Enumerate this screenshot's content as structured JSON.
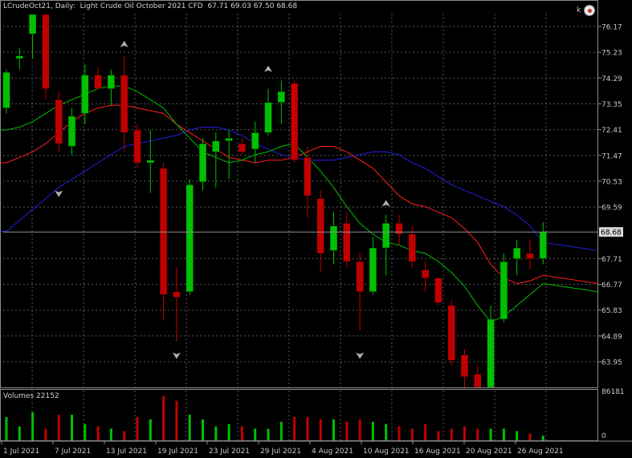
{
  "header": {
    "symbol": "LCrudeOct21",
    "timeframe": "Daily",
    "description": "Light Crude Oil October 2021 CFD",
    "ohlc": "67.71 69.03 67.50 68.68"
  },
  "volumes_label": "Volumes 22152",
  "badge_letter": "k",
  "current_price": "68.68",
  "colors": {
    "bull": "#00c000",
    "bear": "#c00000",
    "ma_fast": "#00c000",
    "ma_mid": "#ff2020",
    "ma_slow": "#2020e0",
    "grid": "#585858",
    "price_line": "#909090"
  },
  "price_axis": [
    "76.17",
    "75.23",
    "74.29",
    "73.35",
    "72.41",
    "71.47",
    "70.53",
    "69.59",
    "67.71",
    "66.77",
    "65.83",
    "64.89",
    "63.95"
  ],
  "volume_axis": [
    "86181",
    "0"
  ],
  "date_axis": [
    "1 Jul 2021",
    "7 Jul 2021",
    "13 Jul 2021",
    "19 Jul 2021",
    "23 Jul 2021",
    "29 Jul 2021",
    "4 Aug 2021",
    "10 Aug 2021",
    "16 Aug 2021",
    "20 Aug 2021",
    "26 Aug 2021"
  ],
  "chart_data": {
    "type": "candlestick",
    "candles": [
      {
        "o": 73.2,
        "h": 74.6,
        "l": 73.0,
        "c": 74.5,
        "v": 0.5
      },
      {
        "o": 75.0,
        "h": 75.4,
        "l": 74.6,
        "c": 75.1,
        "v": 0.3
      },
      {
        "o": 75.9,
        "h": 76.8,
        "l": 75.0,
        "c": 76.9,
        "v": 0.6
      },
      {
        "o": 77.0,
        "h": 77.2,
        "l": 73.5,
        "c": 73.9,
        "v": 0.25
      },
      {
        "o": 73.5,
        "h": 73.8,
        "l": 71.6,
        "c": 71.9,
        "v": 0.55
      },
      {
        "o": 71.8,
        "h": 73.2,
        "l": 71.5,
        "c": 72.9,
        "v": 0.55
      },
      {
        "o": 73.0,
        "h": 74.8,
        "l": 72.6,
        "c": 74.4,
        "v": 0.35
      },
      {
        "o": 74.4,
        "h": 74.7,
        "l": 73.9,
        "c": 73.9,
        "v": 0.3
      },
      {
        "o": 73.9,
        "h": 74.6,
        "l": 73.3,
        "c": 74.4,
        "v": 0.25
      },
      {
        "o": 74.4,
        "h": 75.1,
        "l": 71.6,
        "c": 72.3,
        "v": 0.2
      },
      {
        "o": 72.4,
        "h": 72.6,
        "l": 71.0,
        "c": 71.2,
        "v": 0.5
      },
      {
        "o": 71.2,
        "h": 72.4,
        "l": 70.1,
        "c": 71.3,
        "v": 0.45
      },
      {
        "o": 71.0,
        "h": 71.2,
        "l": 65.5,
        "c": 66.4,
        "v": 0.95
      },
      {
        "o": 66.5,
        "h": 67.4,
        "l": 64.7,
        "c": 66.3,
        "v": 0.85
      },
      {
        "o": 66.5,
        "h": 70.6,
        "l": 66.4,
        "c": 70.4,
        "v": 0.55
      },
      {
        "o": 70.5,
        "h": 72.1,
        "l": 70.2,
        "c": 71.9,
        "v": 0.45
      },
      {
        "o": 71.6,
        "h": 72.3,
        "l": 70.3,
        "c": 72.0,
        "v": 0.3
      },
      {
        "o": 72.0,
        "h": 72.4,
        "l": 70.6,
        "c": 72.1,
        "v": 0.35
      },
      {
        "o": 71.9,
        "h": 72.1,
        "l": 71.5,
        "c": 71.6,
        "v": 0.3
      },
      {
        "o": 71.7,
        "h": 72.7,
        "l": 71.2,
        "c": 72.3,
        "v": 0.25
      },
      {
        "o": 72.3,
        "h": 73.9,
        "l": 72.2,
        "c": 73.4,
        "v": 0.25
      },
      {
        "o": 73.4,
        "h": 74.2,
        "l": 72.6,
        "c": 73.8,
        "v": 0.4
      },
      {
        "o": 74.1,
        "h": 74.2,
        "l": 71.2,
        "c": 71.3,
        "v": 0.5
      },
      {
        "o": 71.4,
        "h": 71.8,
        "l": 69.2,
        "c": 70.0,
        "v": 0.5
      },
      {
        "o": 69.9,
        "h": 70.2,
        "l": 67.2,
        "c": 67.9,
        "v": 0.45
      },
      {
        "o": 68.0,
        "h": 69.4,
        "l": 67.5,
        "c": 68.9,
        "v": 0.45
      },
      {
        "o": 69.0,
        "h": 69.4,
        "l": 67.4,
        "c": 67.6,
        "v": 0.4
      },
      {
        "o": 67.6,
        "h": 67.9,
        "l": 65.1,
        "c": 66.5,
        "v": 0.45
      },
      {
        "o": 66.5,
        "h": 68.5,
        "l": 66.4,
        "c": 68.1,
        "v": 0.4
      },
      {
        "o": 68.1,
        "h": 69.3,
        "l": 67.1,
        "c": 69.0,
        "v": 0.35
      },
      {
        "o": 69.0,
        "h": 69.3,
        "l": 68.2,
        "c": 68.6,
        "v": 0.3
      },
      {
        "o": 68.6,
        "h": 68.9,
        "l": 67.4,
        "c": 67.6,
        "v": 0.25
      },
      {
        "o": 67.3,
        "h": 67.6,
        "l": 66.5,
        "c": 67.0,
        "v": 0.35
      },
      {
        "o": 67.0,
        "h": 67.0,
        "l": 66.0,
        "c": 66.1,
        "v": 0.2
      },
      {
        "o": 66.0,
        "h": 66.2,
        "l": 63.8,
        "c": 64.0,
        "v": 0.25
      },
      {
        "o": 64.2,
        "h": 64.4,
        "l": 62.5,
        "c": 63.4,
        "v": 0.3
      },
      {
        "o": 63.5,
        "h": 63.8,
        "l": 62.8,
        "c": 62.9,
        "v": 0.25
      },
      {
        "o": 63.0,
        "h": 66.0,
        "l": 62.8,
        "c": 65.5,
        "v": 0.25
      },
      {
        "o": 65.5,
        "h": 67.9,
        "l": 65.4,
        "c": 67.6,
        "v": 0.25
      },
      {
        "o": 67.7,
        "h": 68.4,
        "l": 67.1,
        "c": 68.1,
        "v": 0.2
      },
      {
        "o": 67.9,
        "h": 68.4,
        "l": 67.3,
        "c": 67.7,
        "v": 0.15
      },
      {
        "o": 67.71,
        "h": 69.03,
        "l": 67.5,
        "c": 68.68,
        "v": 0.1
      }
    ],
    "ma_fast": [
      72.4,
      72.5,
      72.7,
      73.0,
      73.3,
      73.5,
      73.7,
      73.9,
      74.0,
      74.0,
      73.8,
      73.5,
      73.2,
      72.6,
      72.1,
      71.6,
      71.4,
      71.2,
      71.3,
      71.5,
      71.6,
      71.8,
      71.9,
      71.4,
      70.9,
      70.3,
      69.6,
      69.0,
      68.6,
      68.3,
      68.2,
      68.0,
      67.9,
      67.6,
      67.2,
      66.7,
      66.0,
      65.4,
      65.6,
      66.0,
      66.4,
      66.8
    ],
    "ma_mid": [
      71.2,
      71.4,
      71.6,
      71.9,
      72.3,
      72.7,
      73.0,
      73.2,
      73.3,
      73.3,
      73.2,
      73.1,
      73.0,
      72.6,
      72.3,
      72.0,
      71.7,
      71.4,
      71.3,
      71.2,
      71.3,
      71.3,
      71.4,
      71.6,
      71.8,
      71.8,
      71.6,
      71.3,
      71.0,
      70.5,
      70.0,
      69.7,
      69.6,
      69.4,
      69.2,
      68.8,
      68.3,
      67.5,
      67.0,
      66.8,
      66.9,
      67.1
    ],
    "ma_slow": [
      68.7,
      69.1,
      69.5,
      69.9,
      70.3,
      70.6,
      70.9,
      71.2,
      71.5,
      71.8,
      71.9,
      72.0,
      72.1,
      72.2,
      72.4,
      72.5,
      72.5,
      72.4,
      72.2,
      71.9,
      71.7,
      71.5,
      71.4,
      71.3,
      71.3,
      71.3,
      71.4,
      71.5,
      71.6,
      71.6,
      71.5,
      71.2,
      71.0,
      70.7,
      70.4,
      70.2,
      70.0,
      69.8,
      69.6,
      69.3,
      68.9,
      68.3
    ],
    "arrows_up": [
      {
        "i": 9,
        "p": 75.5
      },
      {
        "i": 20,
        "p": 74.6
      },
      {
        "i": 29,
        "p": 69.7
      }
    ],
    "arrows_down": [
      {
        "i": 4,
        "p": 70.1
      },
      {
        "i": 13,
        "p": 64.2
      },
      {
        "i": 27,
        "p": 64.2
      }
    ]
  }
}
